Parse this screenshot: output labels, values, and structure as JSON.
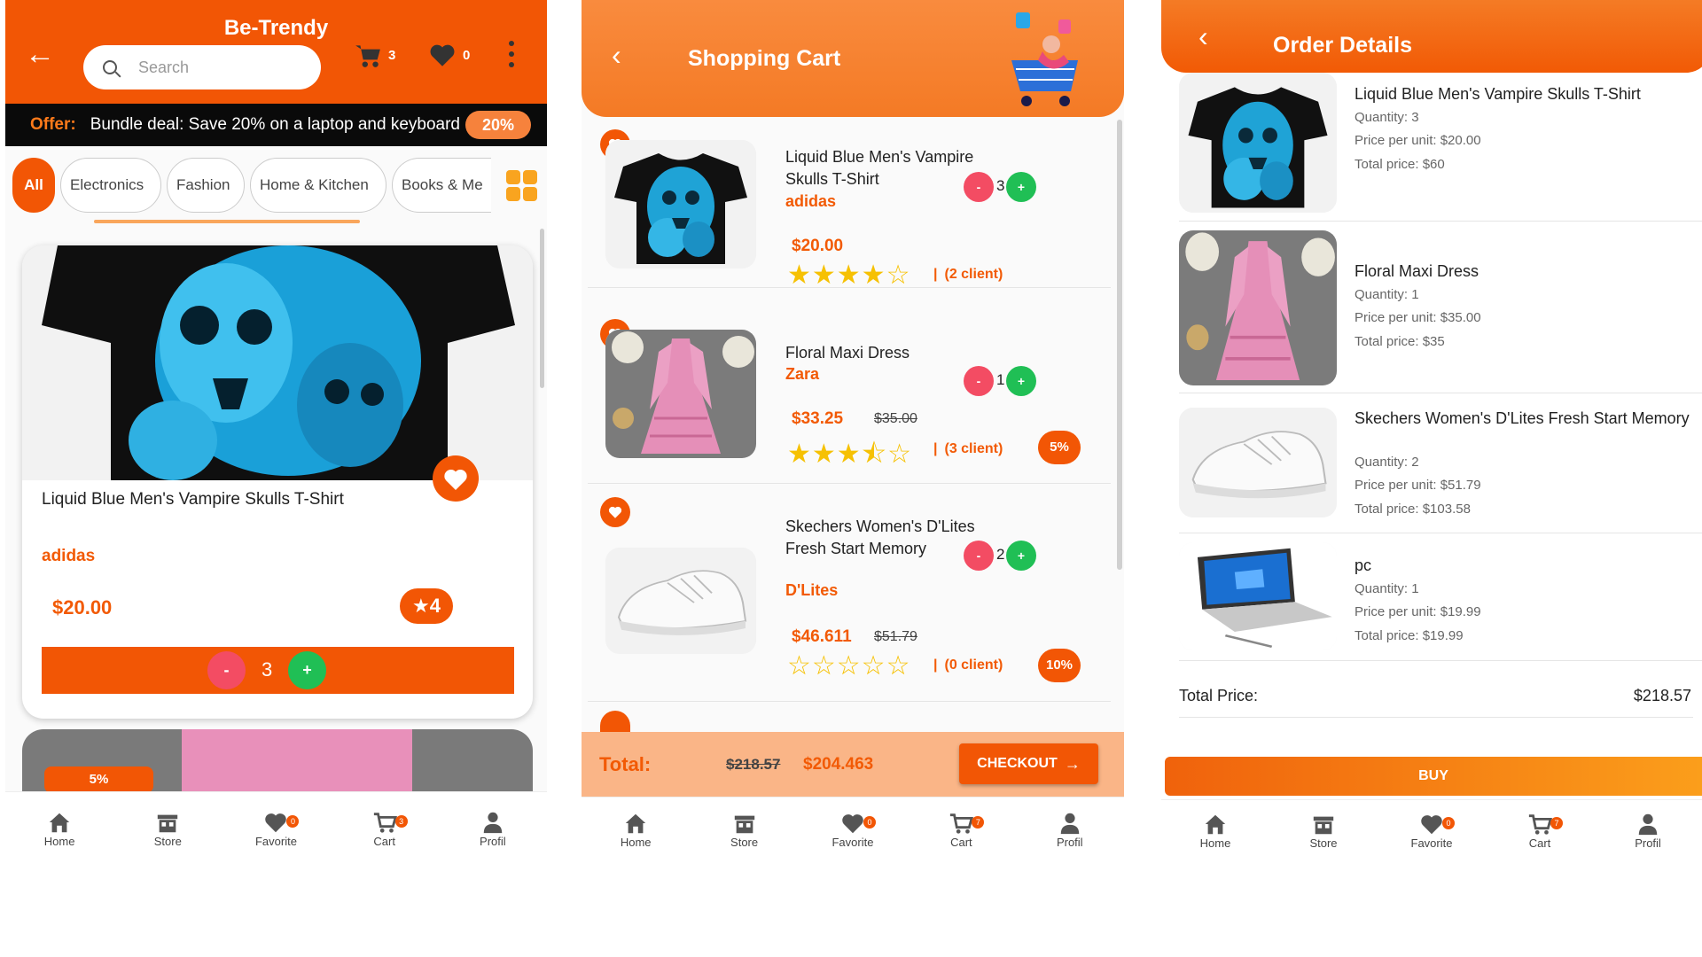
{
  "screen1": {
    "app_title": "Be-Trendy",
    "search_placeholder": "Search",
    "cart_count": "3",
    "favorite_count": "0",
    "offer": {
      "label": "Offer:",
      "text": "Bundle deal: Save 20% on a laptop and keyboard",
      "percent": "20%"
    },
    "categories": [
      "All",
      "Electronics",
      "Fashion",
      "Home & Kitchen",
      "Books & Me"
    ],
    "product": {
      "title": "Liquid Blue Men's Vampire Skulls T-Shirt",
      "brand": "adidas",
      "price": "$20.00",
      "rating": "4",
      "qty_minus": "-",
      "qty": "3",
      "qty_plus": "+"
    },
    "next_card_badge": "5%"
  },
  "screen2": {
    "title": "Shopping Cart",
    "items": [
      {
        "title": "Liquid Blue Men's Vampire Skulls T-Shirt",
        "brand": "adidas",
        "price": "$20.00",
        "old_price": "",
        "stars": "★★★★☆",
        "clients": "(2 client)",
        "qty": "3",
        "discount": ""
      },
      {
        "title": "Floral Maxi Dress",
        "brand": "Zara",
        "price": "$33.25",
        "old_price": "$35.00",
        "stars": "★★★⯪☆",
        "clients": "(3 client)",
        "qty": "1",
        "discount": "5%"
      },
      {
        "title": "Skechers Women's D'Lites Fresh Start Memory",
        "brand": "D'Lites",
        "price": "$46.611",
        "old_price": "$51.79",
        "stars": "☆☆☆☆☆",
        "clients": "(0 client)",
        "qty": "2",
        "discount": "10%"
      }
    ],
    "total_label": "Total:",
    "total_old": "$218.57",
    "total_new": "$204.463",
    "checkout_label": "CHECKOUT"
  },
  "screen3": {
    "title": "Order Details",
    "items": [
      {
        "title": "Liquid Blue Men's Vampire Skulls T-Shirt",
        "quantity": "Quantity: 3",
        "unit_price": "Price per unit: $20.00",
        "total": "Total price: $60"
      },
      {
        "title": "Floral Maxi Dress",
        "quantity": "Quantity: 1",
        "unit_price": "Price per unit: $35.00",
        "total": "Total price: $35"
      },
      {
        "title": "Skechers Women's D'Lites Fresh Start Memory",
        "quantity": "Quantity: 2",
        "unit_price": "Price per unit: $51.79",
        "total": "Total price: $103.58"
      },
      {
        "title": "pc",
        "quantity": "Quantity: 1",
        "unit_price": "Price per unit: $19.99",
        "total": "Total price: $19.99"
      }
    ],
    "total_label": "Total Price:",
    "total_value": "$218.57",
    "buy_label": "BUY"
  },
  "nav": {
    "items": [
      "Home",
      "Store",
      "Favorite",
      "Cart",
      "Profil"
    ],
    "favorite_badge": "0",
    "cart_badge_s1": "3",
    "cart_badge_s2": "7",
    "cart_badge_s3": "7"
  },
  "colors": {
    "primary": "#f25605",
    "accent": "#f6823c",
    "star": "#f6c103",
    "plus": "#20bf55",
    "minus": "#f34c63"
  }
}
